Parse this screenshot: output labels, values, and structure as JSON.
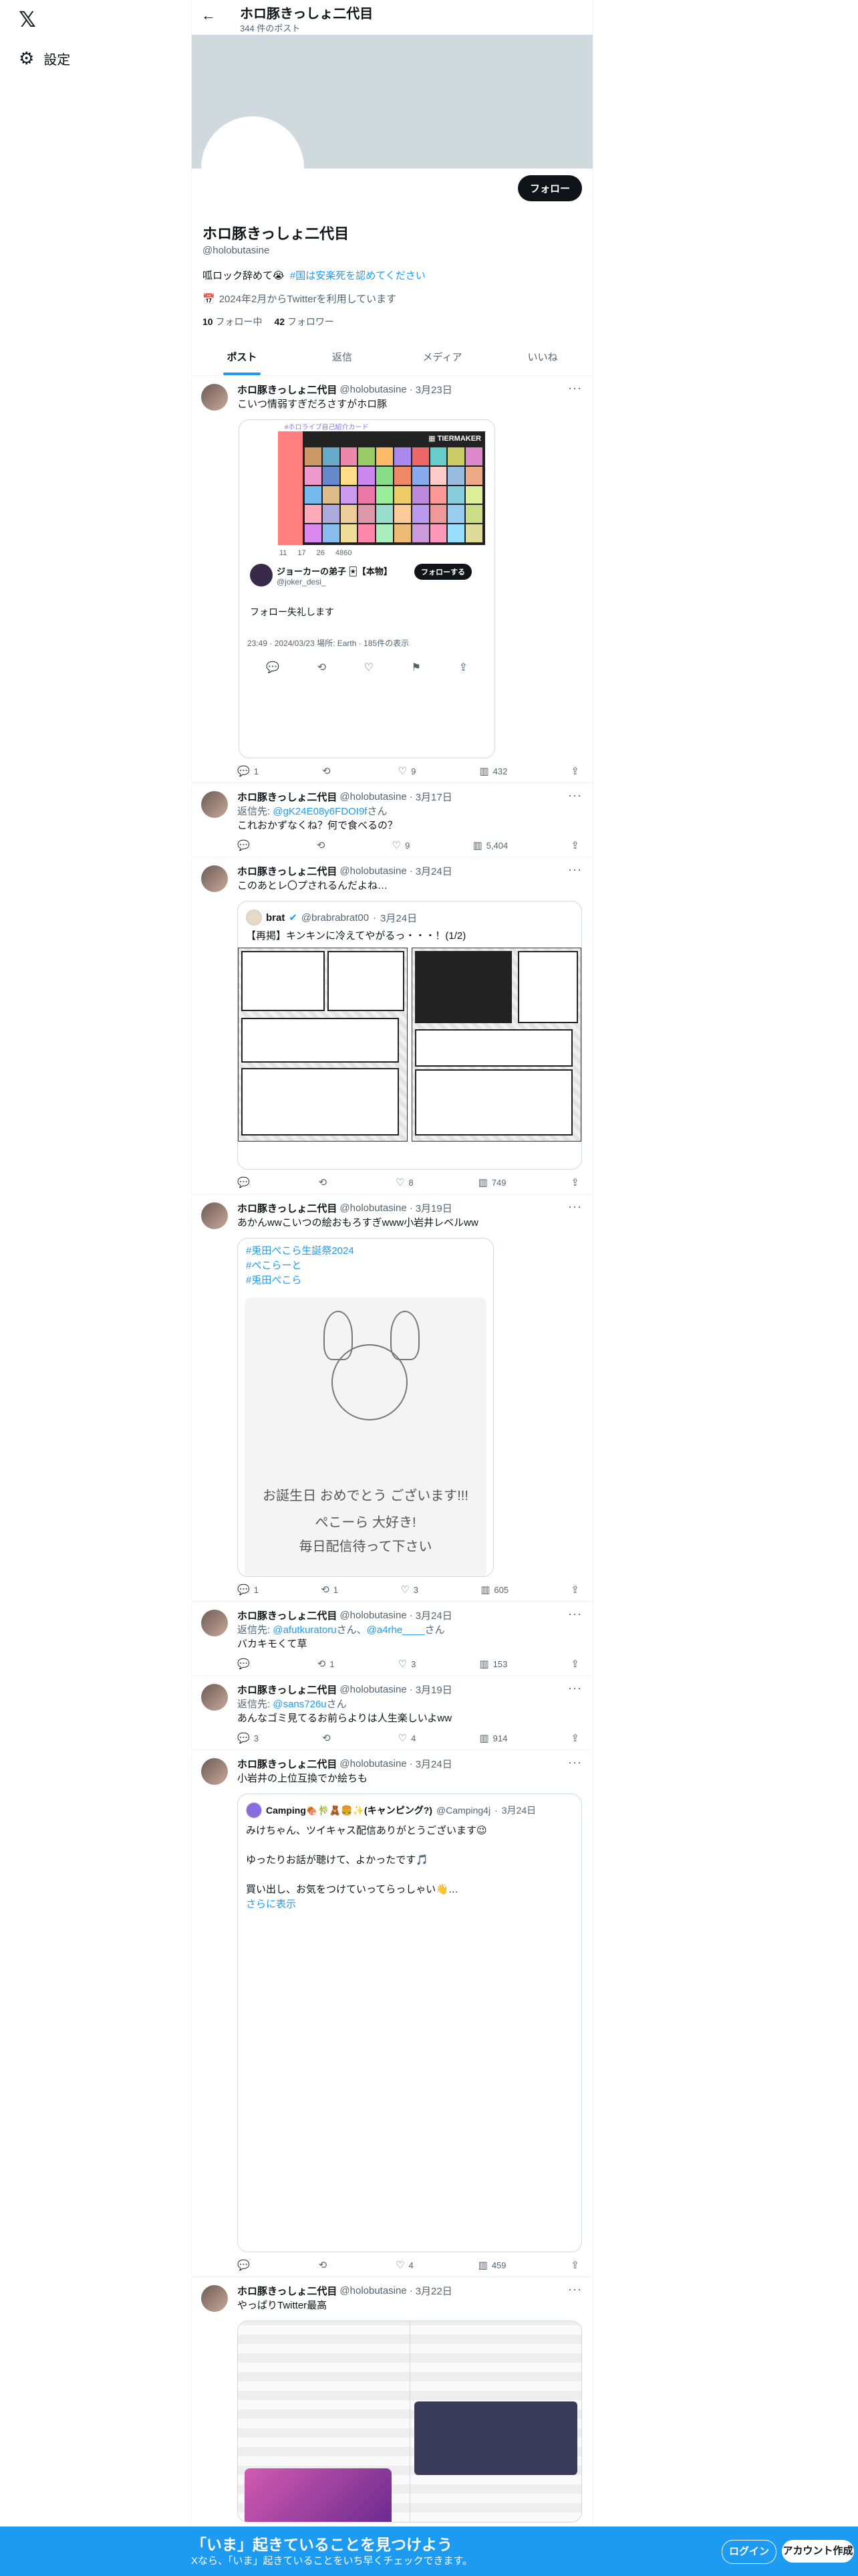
{
  "nav": {
    "settings_label": "設定"
  },
  "header": {
    "title": "ホロ豚きっしょ二代目",
    "posts_count": "344 件のポスト"
  },
  "profile": {
    "follow_label": "フォロー",
    "name": "ホロ豚きっしょ二代目",
    "handle": "@holobutasine",
    "bio_text": "呱ロック辞めて😭",
    "bio_link": "#国は安楽死を認めてください",
    "joined": "2024年2月からTwitterを利用しています",
    "following_count": "10",
    "following_label": "フォロー中",
    "followers_count": "42",
    "followers_label": "フォロワー"
  },
  "tabs": [
    "ポスト",
    "返信",
    "メディア",
    "いいね"
  ],
  "tweets": [
    {
      "name": "ホロ豚きっしょ二代目",
      "handle": "@holobutasine",
      "date": "3月23日",
      "text": "こいつ情弱すぎだろさすがホロ豚",
      "card": {
        "subtitle": "#ホロライブ自己紹介カード",
        "stats": [
          "11",
          "17",
          "26",
          "4860"
        ],
        "qname": "ジョーカーの弟子 🃏【本物】",
        "qhandle": "@joker_desi_",
        "follow": "フォローする",
        "qtext": "フォロー失礼します",
        "qmeta": "23:49 · 2024/03/23 場所: Earth · 185件の表示"
      },
      "replies": "1",
      "rts": "",
      "likes": "9",
      "views": "432"
    },
    {
      "name": "ホロ豚きっしょ二代目",
      "handle": "@holobutasine",
      "date": "3月17日",
      "reply_prefix": "返信先:",
      "reply_handle": "@gK24E08y6FDOI9f",
      "reply_suffix": "さん",
      "text": "これおかずなくね？何で食べるの？",
      "replies": "",
      "rts": "",
      "likes": "9",
      "views": "5,404"
    },
    {
      "name": "ホロ豚きっしょ二代目",
      "handle": "@holobutasine",
      "date": "3月24日",
      "text": "このあとレ〇プされるんだよね…",
      "quote": {
        "name": "brat",
        "handle": "@brabrabrat00",
        "date": "3月24日",
        "text": "【再掲】キンキンに冷えてやがるっ・・・！(1/2)"
      },
      "replies": "",
      "rts": "",
      "likes": "8",
      "views": "749"
    },
    {
      "name": "ホロ豚きっしょ二代目",
      "handle": "@holobutasine",
      "date": "3月19日",
      "text": "あかんwwこいつの絵おもろすぎwww小岩井レベルww",
      "card_tags": [
        "#兎田ぺこら生誕祭2024",
        "#ぺこらーと",
        "#兎田ぺこら"
      ],
      "sketch_lines": [
        "お誕生日 おめでとう ございます!!!",
        "ぺこーら 大好き!",
        "毎日配信待って下さい"
      ],
      "replies": "1",
      "rts": "1",
      "likes": "3",
      "views": "605"
    },
    {
      "name": "ホロ豚きっしょ二代目",
      "handle": "@holobutasine",
      "date": "3月24日",
      "reply_prefix": "返信先:",
      "reply_handle": "@afutkuratoru",
      "reply_mid": "さん、",
      "reply_handle2": "@a4rhe____",
      "reply_suffix": "さん",
      "text": "バカキモくて草",
      "replies": "",
      "rts": "1",
      "likes": "3",
      "views": "153"
    },
    {
      "name": "ホロ豚きっしょ二代目",
      "handle": "@holobutasine",
      "date": "3月19日",
      "reply_prefix": "返信先:",
      "reply_handle": "@sans726u",
      "reply_suffix": "さん",
      "text": "あんなゴミ見てるお前らよりは人生楽しいよww",
      "replies": "3",
      "rts": "",
      "likes": "4",
      "views": "914"
    },
    {
      "name": "ホロ豚きっしょ二代目",
      "handle": "@holobutasine",
      "date": "3月24日",
      "text": "小岩井の上位互換でか絵ちも",
      "quote": {
        "name": "Camping🍖🎋🧸🍔✨(キャンピング?)",
        "handle": "@Camping4j",
        "date": "3月24日",
        "lines": [
          "みけちゃん、ツイキャス配信ありがとうございます😉",
          "",
          "ゆったりお話が聴けて、よかったです🎵",
          "",
          "買い出し、お気をつけていってらっしゃい👋…"
        ],
        "more": "さらに表示"
      },
      "replies": "",
      "rts": "",
      "likes": "4",
      "views": "459"
    },
    {
      "name": "ホロ豚きっしょ二代目",
      "handle": "@holobutasine",
      "date": "3月22日",
      "text": "やっぱりTwitter最高"
    }
  ],
  "bottom": {
    "title": "「いま」起きていることを見つけよう",
    "sub": "Xなら、「いま」起きていることをいち早くチェックできます。",
    "login": "ログイン",
    "create": "アカウント作成"
  }
}
